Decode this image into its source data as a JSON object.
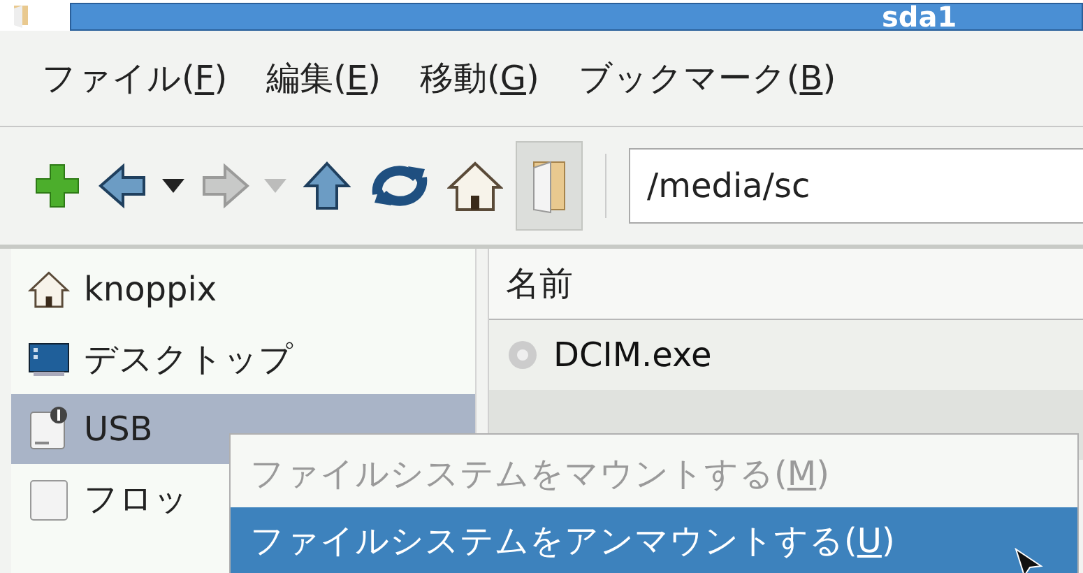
{
  "window": {
    "title": "sda1"
  },
  "menubar": [
    {
      "before": "ファイル(",
      "key": "F",
      "after": ")"
    },
    {
      "before": "編集(",
      "key": "E",
      "after": ")"
    },
    {
      "before": "移動(",
      "key": "G",
      "after": ")"
    },
    {
      "before": "ブックマーク(",
      "key": "B",
      "after": ")"
    }
  ],
  "toolbar": [
    {
      "kind": "add",
      "disabled": false,
      "pressed": false
    },
    {
      "kind": "back",
      "disabled": false,
      "pressed": false
    },
    {
      "kind": "caret",
      "disabled": false,
      "pressed": false
    },
    {
      "kind": "forward",
      "disabled": true,
      "pressed": false
    },
    {
      "kind": "caret",
      "disabled": true,
      "pressed": false
    },
    {
      "kind": "up",
      "disabled": false,
      "pressed": false
    },
    {
      "kind": "reload",
      "disabled": false,
      "pressed": false
    },
    {
      "kind": "home",
      "disabled": false,
      "pressed": false
    },
    {
      "kind": "folder",
      "disabled": false,
      "pressed": true
    }
  ],
  "location": {
    "value": "/media/sc"
  },
  "sidebar": {
    "items": [
      {
        "label": "knoppix",
        "kind": "home",
        "selected": false
      },
      {
        "label": "デスクトップ",
        "kind": "desktop",
        "selected": false
      },
      {
        "label": "USB",
        "kind": "usb",
        "selected": true
      },
      {
        "label": "フロッ",
        "kind": "floppy",
        "selected": false
      }
    ]
  },
  "file_list": {
    "columns": [
      "名前"
    ],
    "rows": [
      {
        "name": "DCIM.exe"
      }
    ]
  },
  "context_menu": {
    "items": [
      {
        "before": "ファイルシステムをマウントする(",
        "key": "M",
        "after": ")",
        "disabled": true,
        "selected": false
      },
      {
        "before": "ファイルシステムをアンマウントする(",
        "key": "U",
        "after": ")",
        "disabled": false,
        "selected": true
      }
    ]
  }
}
